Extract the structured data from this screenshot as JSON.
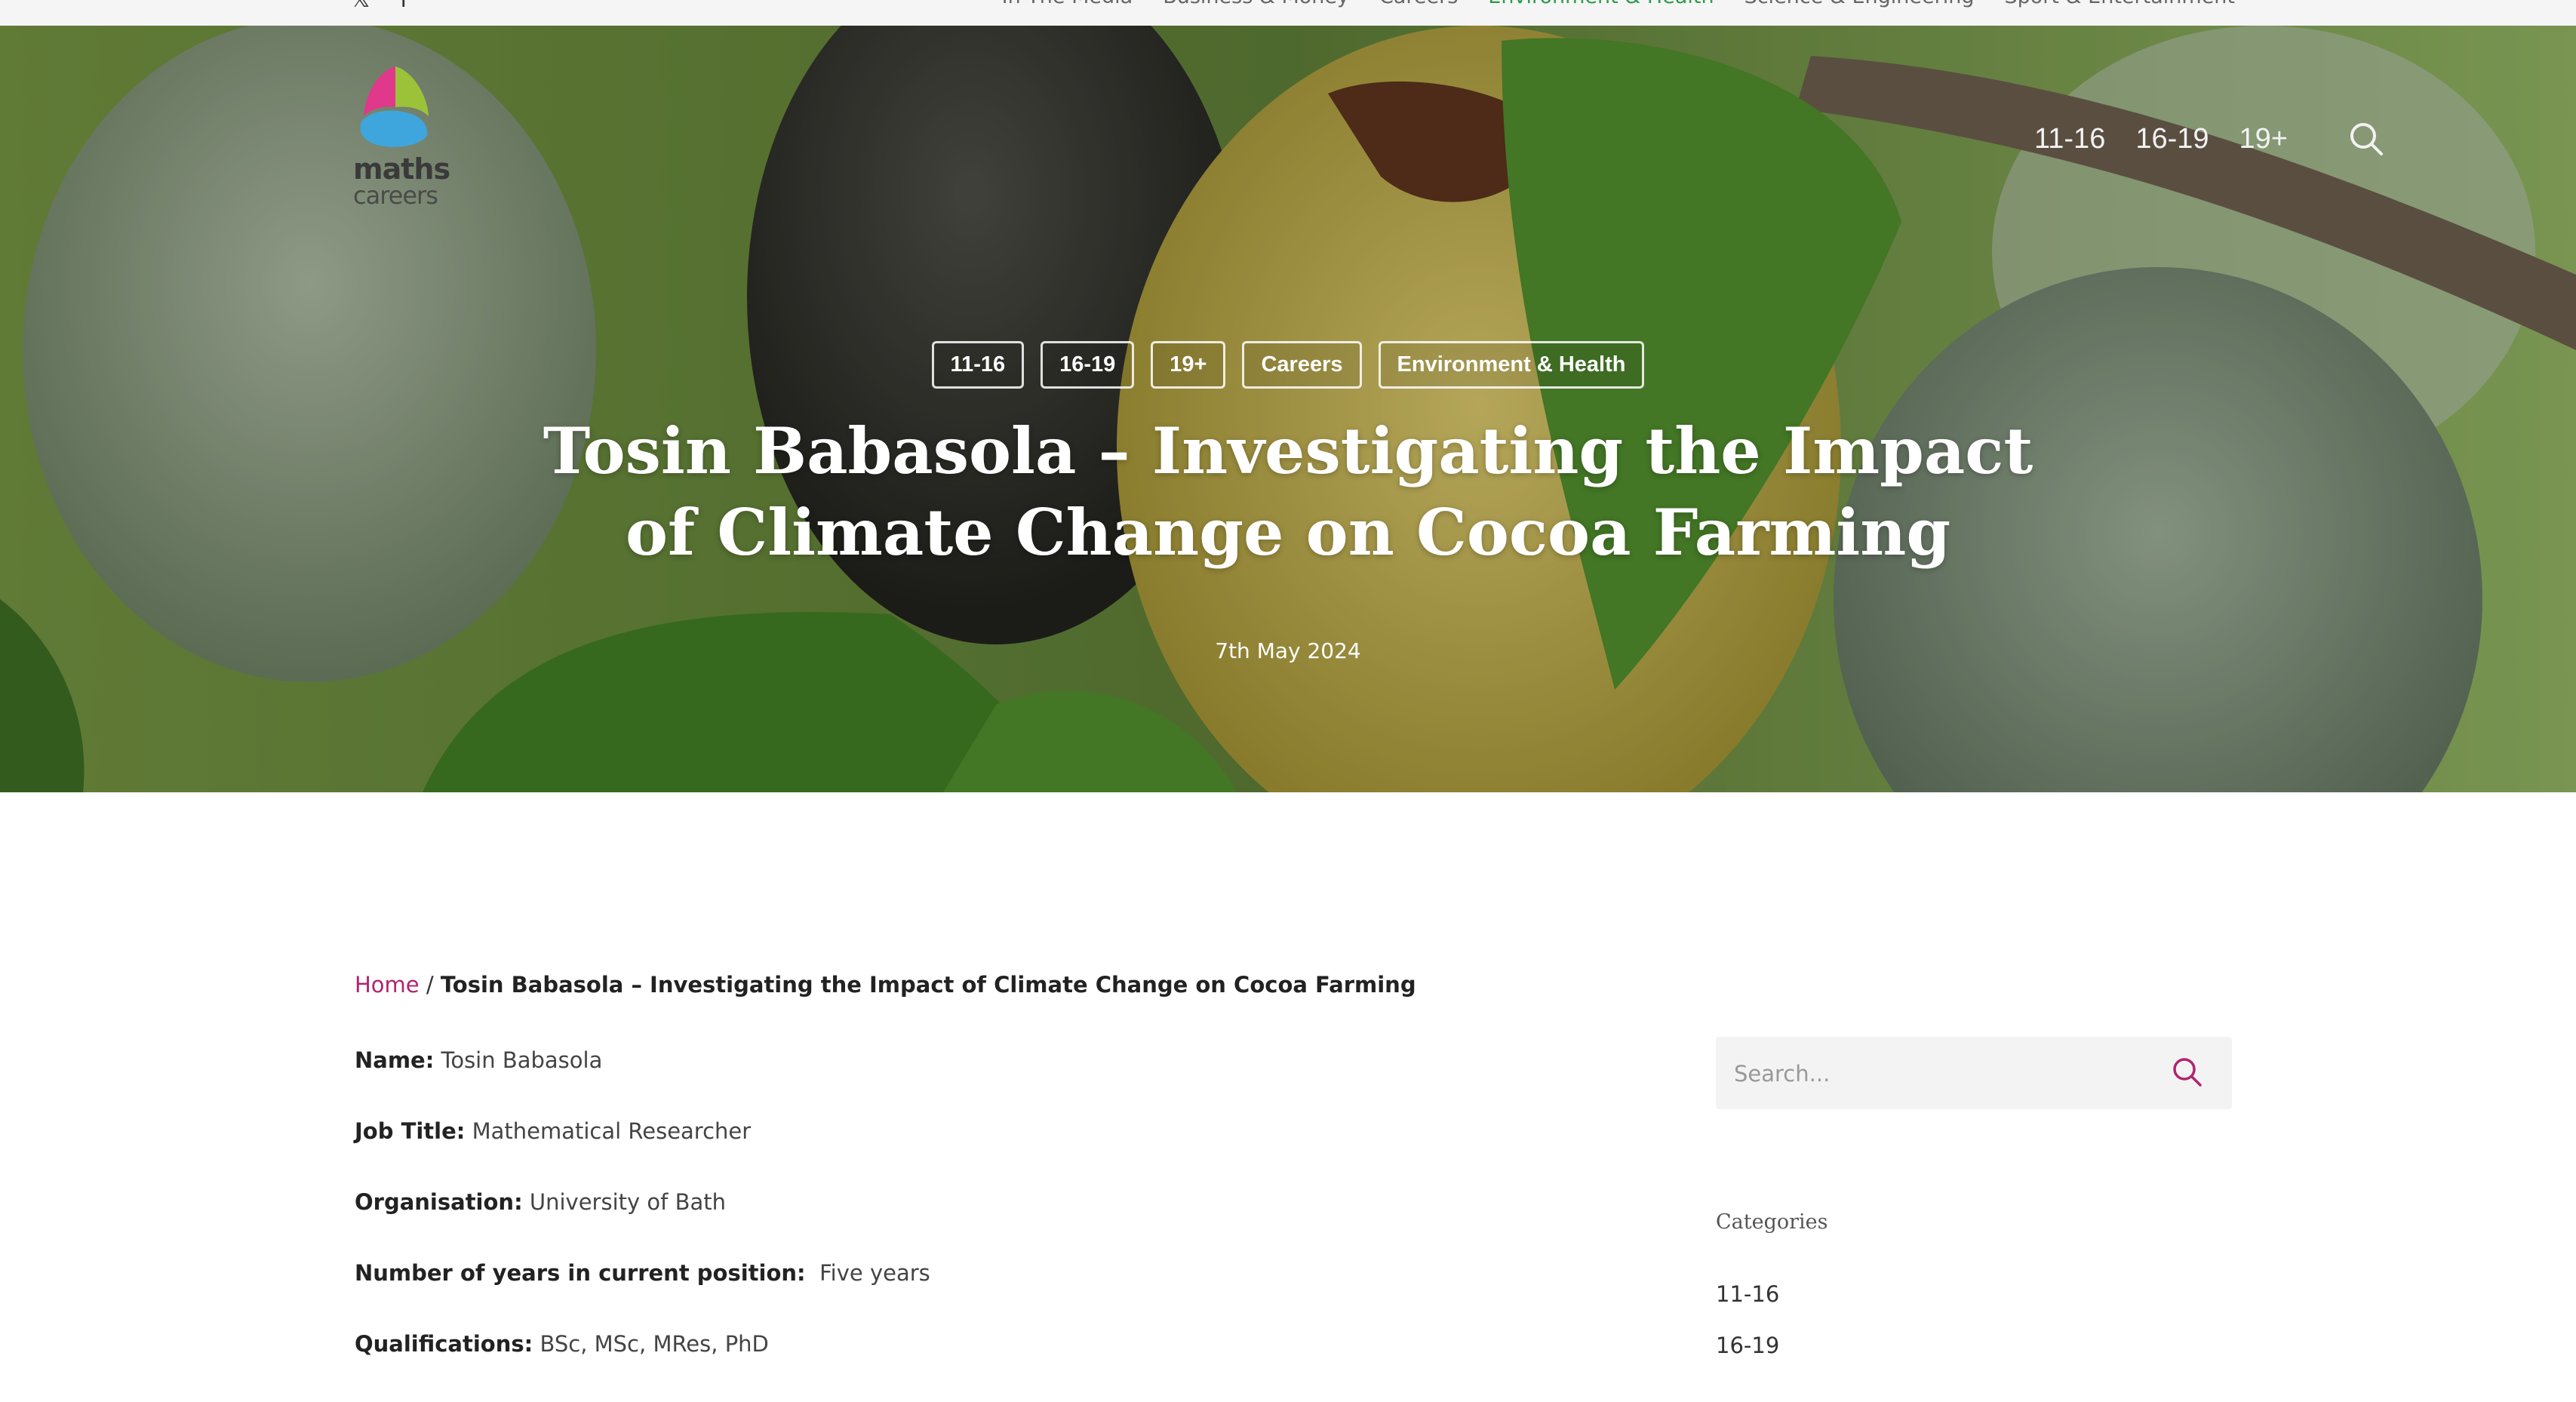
{
  "top_bar": {
    "social": [
      {
        "icon": "x-icon",
        "glyph": "𝕏"
      },
      {
        "icon": "facebook-icon",
        "glyph": "f"
      }
    ],
    "nav": [
      {
        "label": "In The Media"
      },
      {
        "label": "Business & Money"
      },
      {
        "label": "Careers"
      },
      {
        "label": "Environment & Health",
        "active": true
      },
      {
        "label": "Science & Engineering"
      },
      {
        "label": "Sport & Entertainment"
      }
    ]
  },
  "logo": {
    "line1": "maths",
    "line2": "careers"
  },
  "main_nav": {
    "items": [
      "11-16",
      "16-19",
      "19+"
    ],
    "search_icon": "search-icon"
  },
  "hero": {
    "tags": [
      "11-16",
      "16-19",
      "19+",
      "Careers",
      "Environment & Health"
    ],
    "title": "Tosin Babasola – Investigating the Impact of Climate Change on Cocoa Farming",
    "date": "7th May 2024"
  },
  "breadcrumb": {
    "home": "Home",
    "separator": "/",
    "current": "Tosin Babasola – Investigating the Impact of Climate Change on Cocoa Farming"
  },
  "details": [
    {
      "label": "Name:",
      "value": "Tosin Babasola"
    },
    {
      "label": "Job Title:",
      "value": "Mathematical Researcher"
    },
    {
      "label": "Organisation:",
      "value": "University of Bath"
    },
    {
      "label": "Number of years in current position:",
      "value": " Five years"
    },
    {
      "label": "Qualifications:",
      "value": "BSc, MSc, MRes, PhD"
    }
  ],
  "sidebar": {
    "search_placeholder": "Search...",
    "categories_title": "Categories",
    "categories": [
      "11-16",
      "16-19"
    ]
  },
  "colors": {
    "accent": "#b0246f",
    "active_nav": "#2e9a4a",
    "search_bg": "#f3f3f3"
  }
}
